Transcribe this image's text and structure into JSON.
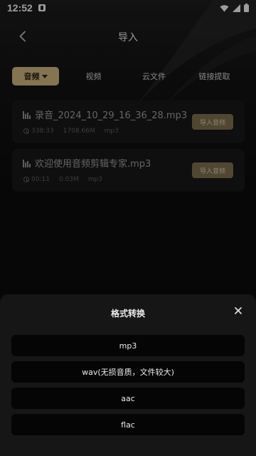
{
  "status_bar": {
    "time": "12:52",
    "icons": [
      "notification-icon",
      "wifi-icon",
      "signal-icon",
      "battery-icon"
    ]
  },
  "header": {
    "title": "导入",
    "back_icon": "chevron-left-icon"
  },
  "tabs": [
    {
      "label": "音频",
      "active": true
    },
    {
      "label": "视频",
      "active": false
    },
    {
      "label": "云文件",
      "active": false
    },
    {
      "label": "链接提取",
      "active": false
    }
  ],
  "files": [
    {
      "name": "录音_2024_10_29_16_36_28.mp3",
      "duration": "338:33",
      "size": "1708.66M",
      "format": "mp3",
      "action": "导入音频"
    },
    {
      "name": "欢迎使用音频剪辑专家.mp3",
      "duration": "00:11",
      "size": "0.03M",
      "format": "mp3",
      "action": "导入音频"
    }
  ],
  "sheet": {
    "title": "格式转换",
    "close_icon": "close-icon",
    "options": [
      "mp3",
      "wav(无损音质，文件较大)",
      "aac",
      "flac"
    ]
  },
  "colors": {
    "accent": "#c9b27f",
    "button_bg": "#7b6d4f",
    "card_bg": "#171717",
    "sheet_bg": "#161616"
  }
}
